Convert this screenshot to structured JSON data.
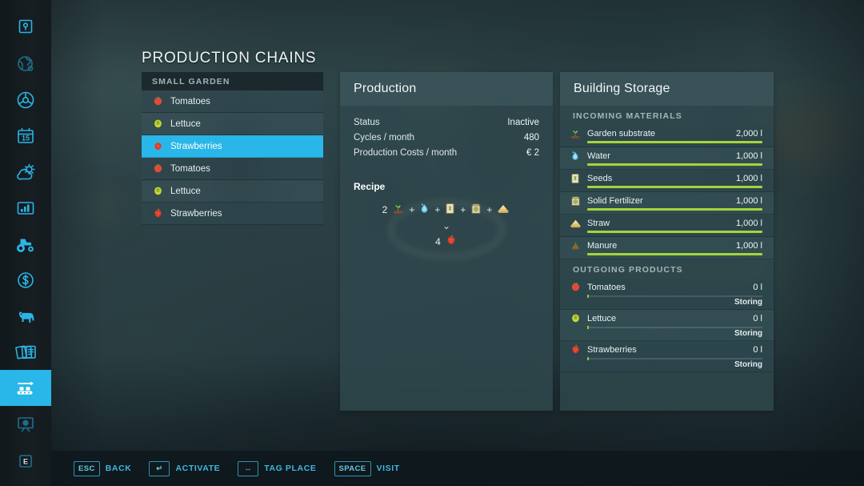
{
  "page": {
    "title": "PRODUCTION CHAINS"
  },
  "sidebar": {
    "active_index": 9,
    "items": [
      {
        "name": "map-pin-icon",
        "label": "Map"
      },
      {
        "name": "globe-settings-icon",
        "label": "World"
      },
      {
        "name": "steering-wheel-icon",
        "label": "Vehicles"
      },
      {
        "name": "calendar-icon",
        "label": "Calendar",
        "value": "15"
      },
      {
        "name": "weather-icon",
        "label": "Weather"
      },
      {
        "name": "statistics-icon",
        "label": "Statistics"
      },
      {
        "name": "tractor-icon",
        "label": "Vehicles List"
      },
      {
        "name": "finances-icon",
        "label": "Finances"
      },
      {
        "name": "animals-icon",
        "label": "Animals"
      },
      {
        "name": "contracts-icon",
        "label": "Contracts"
      },
      {
        "name": "production-chains-icon",
        "label": "Production Chains"
      },
      {
        "name": "gallery-icon",
        "label": "Gallery"
      },
      {
        "name": "key-e-icon",
        "label": "E",
        "value": "E"
      }
    ]
  },
  "production_list": {
    "group_header": "SMALL GARDEN",
    "selected_index": 2,
    "rows": [
      {
        "icon": "tomato-icon",
        "label": "Tomatoes"
      },
      {
        "icon": "lettuce-icon",
        "label": "Lettuce"
      },
      {
        "icon": "strawberry-icon",
        "label": "Strawberries"
      },
      {
        "icon": "tomato-icon",
        "label": "Tomatoes"
      },
      {
        "icon": "lettuce-icon",
        "label": "Lettuce"
      },
      {
        "icon": "strawberry-icon",
        "label": "Strawberries"
      }
    ]
  },
  "production": {
    "title": "Production",
    "stats": [
      {
        "label": "Status",
        "value": "Inactive"
      },
      {
        "label": "Cycles / month",
        "value": "480"
      },
      {
        "label": "Production Costs / month",
        "value": "€ 2"
      }
    ],
    "recipe_title": "Recipe",
    "recipe_inputs": [
      {
        "amount": "2",
        "icon": "garden-substrate-icon",
        "label": "Garden substrate"
      },
      {
        "amount": "",
        "icon": "water-icon",
        "label": "Water"
      },
      {
        "amount": "",
        "icon": "seeds-icon",
        "label": "Seeds"
      },
      {
        "amount": "",
        "icon": "solid-fertilizer-icon",
        "label": "Solid Fertilizer"
      },
      {
        "amount": "",
        "icon": "straw-icon",
        "label": "Straw"
      }
    ],
    "plus_symbol": "+",
    "arrow_symbol": "⌄",
    "recipe_output": {
      "amount": "4",
      "icon": "strawberry-icon",
      "label": "Strawberries"
    }
  },
  "storage": {
    "title": "Building Storage",
    "incoming_header": "INCOMING MATERIALS",
    "incoming": [
      {
        "icon": "garden-substrate-icon",
        "label": "Garden substrate",
        "value": "2,000 l",
        "fill_pct": 100
      },
      {
        "icon": "water-icon",
        "label": "Water",
        "value": "1,000 l",
        "fill_pct": 100
      },
      {
        "icon": "seeds-icon",
        "label": "Seeds",
        "value": "1,000 l",
        "fill_pct": 100
      },
      {
        "icon": "solid-fertilizer-icon",
        "label": "Solid Fertilizer",
        "value": "1,000 l",
        "fill_pct": 100
      },
      {
        "icon": "straw-icon",
        "label": "Straw",
        "value": "1,000 l",
        "fill_pct": 100
      },
      {
        "icon": "manure-icon",
        "label": "Manure",
        "value": "1,000 l",
        "fill_pct": 100
      }
    ],
    "outgoing_header": "OUTGOING PRODUCTS",
    "outgoing": [
      {
        "icon": "tomato-icon",
        "label": "Tomatoes",
        "value": "0 l",
        "status": "Storing",
        "fill_pct": 1
      },
      {
        "icon": "lettuce-icon",
        "label": "Lettuce",
        "value": "0 l",
        "status": "Storing",
        "fill_pct": 1
      },
      {
        "icon": "strawberry-icon",
        "label": "Strawberries",
        "value": "0 l",
        "status": "Storing",
        "fill_pct": 1
      }
    ]
  },
  "helpbar": {
    "items": [
      {
        "key": "ESC",
        "label": "BACK"
      },
      {
        "key": "↵",
        "label": "ACTIVATE"
      },
      {
        "key": "↔",
        "label": "TAG PLACE"
      },
      {
        "key": "SPACE",
        "label": "VISIT"
      }
    ]
  },
  "colors": {
    "accent": "#29b6e8",
    "bar_green": "#a4d43b",
    "panel_bg": "#2f494e",
    "sidebar_bg": "#161e22"
  }
}
